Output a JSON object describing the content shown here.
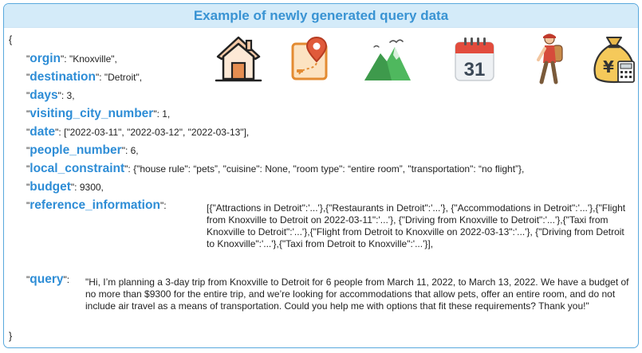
{
  "title": "Example of newly generated query data",
  "open_brace": "{",
  "close_brace": "}",
  "quote": "\"",
  "sep": "\": ",
  "fields": {
    "orgin": {
      "key": "orgin",
      "value": "\"Knoxville\","
    },
    "destination": {
      "key": "destination",
      "value": "\"Detroit\","
    },
    "days": {
      "key": "days",
      "value": "3,"
    },
    "visiting_city_number": {
      "key": "visiting_city_number",
      "value": "1,"
    },
    "date": {
      "key": "date",
      "value": "[\"2022-03-11\", \"2022-03-12\", \"2022-03-13\"],"
    },
    "people_number": {
      "key": "people_number",
      "value": "6,"
    },
    "local_constraint": {
      "key": "local_constraint",
      "value": "{\"house rule\": “pets”, \"cuisine\": None, \"room type\": “entire room”, \"transportation\": “no flight”},"
    },
    "budget": {
      "key": "budget",
      "value": "9300,"
    },
    "reference_information": {
      "key": "reference_information",
      "value": "[{\"Attractions in Detroit\":'...'},{\"Restaurants in Detroit\":'...'}, {\"Accommodations in Detroit\":'...'},{\"Flight from Knoxville to Detroit on 2022-03-11\":'...'}, {\"Driving from Knoxville to Detroit\":'...'},{\"Taxi from Knoxville to Detroit\":'...'},{\"Flight from Detroit to Knoxville on 2022-03-13\":'...'}, {\"Driving from Detroit to Knoxville\":'...'},{\"Taxi from Detroit to Knoxville\":'...'}],"
    },
    "query": {
      "key": "query",
      "value": "\"Hi, I’m planning a 3-day trip from Knoxville to Detroit for 6 people from March 11, 2022, to March 13, 2022. We have a budget of no more than $9300 for the entire trip, and we’re looking for accommodations that allow pets, offer an entire room, and do not include air travel as a means of transportation. Could you help me with options that fit these requirements? Thank you!\""
    }
  },
  "calendar_day": "31",
  "money_symbol": "¥",
  "icons": [
    "house-icon",
    "map-pin-icon",
    "mountain-icon",
    "calendar-icon",
    "traveler-icon",
    "money-bag-icon"
  ],
  "colors": {
    "accent": "#2e8dd6",
    "title_bg": "#d4ebf9",
    "border": "#58a8dd"
  }
}
